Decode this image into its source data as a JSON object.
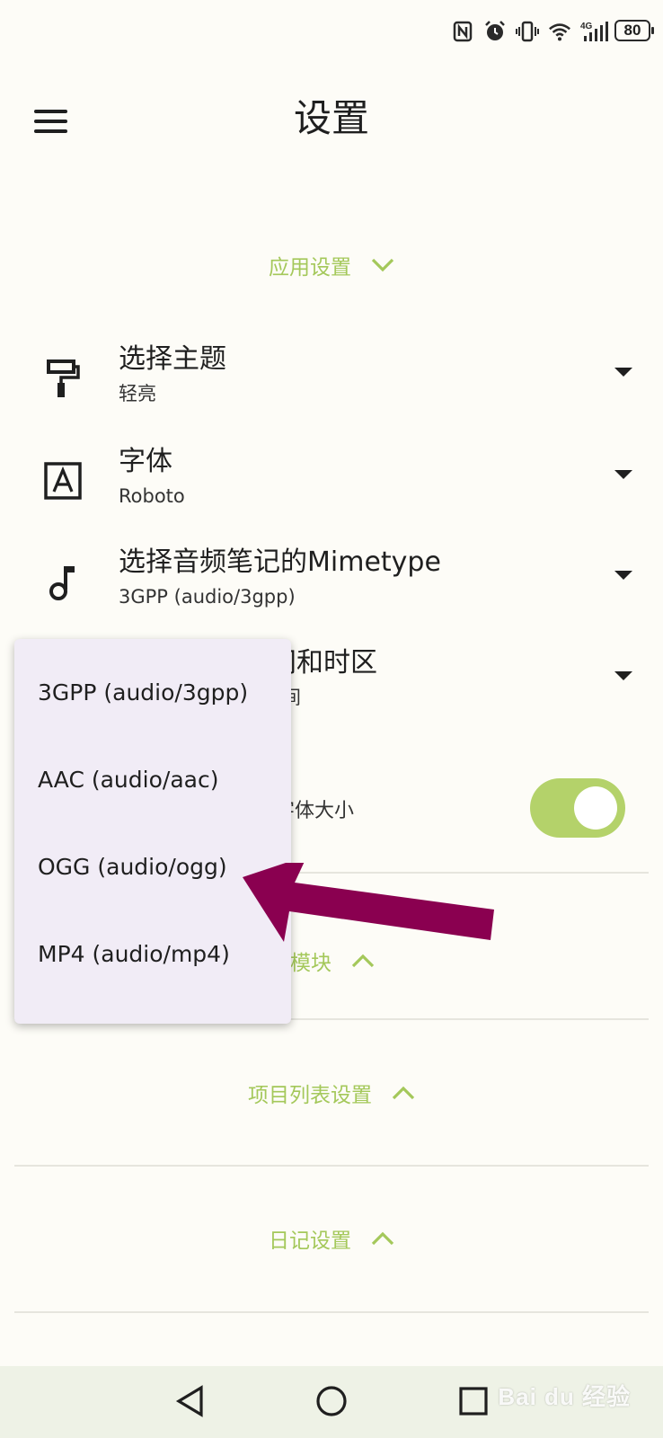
{
  "status_bar": {
    "battery": "80",
    "icons": [
      "nfc-icon",
      "alarm-icon",
      "vibrate-icon",
      "wifi-icon",
      "4g-signal-icon"
    ],
    "network_label": "4G"
  },
  "app_bar": {
    "title": "设置",
    "menu_icon": "hamburger-menu-icon"
  },
  "sections": {
    "app_settings": "应用设置",
    "project_list_settings": "项目列表设置",
    "diary_settings": "日记设置",
    "partial_module": "话模块"
  },
  "settings": [
    {
      "title": "选择主题",
      "value": "轻亮",
      "icon": "paint-roller-icon"
    },
    {
      "title": "字体",
      "value": "Roboto",
      "icon": "font-a-icon"
    },
    {
      "title": "选择音频笔记的Mimetype",
      "value": "3GPP (audio/3gpp)",
      "icon": "music-note-icon"
    },
    {
      "title": "间和时区",
      "value": "间"
    }
  ],
  "toggle_row": {
    "sub": "小字体大小",
    "on": true
  },
  "dropdown": {
    "options": [
      "3GPP (audio/3gpp)",
      "AAC (audio/aac)",
      "OGG (audio/ogg)",
      "MP4 (audio/mp4)"
    ]
  },
  "navigation": {
    "icons": [
      "back-triangle-icon",
      "home-circle-icon",
      "recents-square-icon"
    ]
  },
  "watermark": "Bai du 经验",
  "colors": {
    "accent_green": "#a4c85a",
    "toggle_green": "#b4d26a",
    "dropdown_bg": "#f1ecf6",
    "annotation_arrow": "#8a0050",
    "background": "#fdfcf7"
  }
}
